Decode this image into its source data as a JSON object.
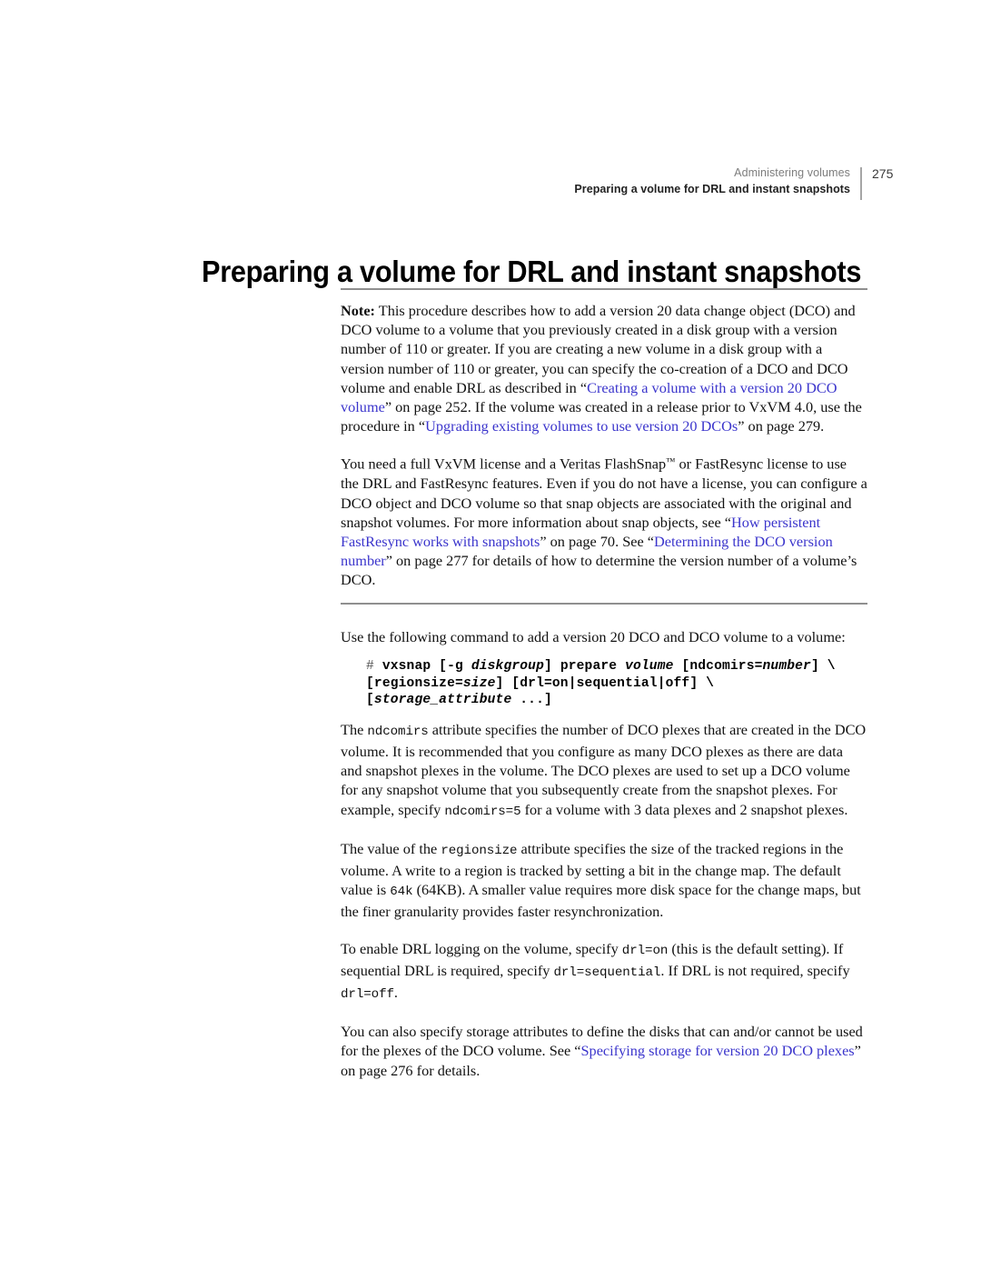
{
  "header": {
    "book_section": "Administering volumes",
    "topic": "Preparing a volume for DRL and instant snapshots",
    "page_number": "275"
  },
  "chapter_title": "Preparing a volume for DRL and instant snapshots",
  "note": {
    "label": "Note:",
    "text_1": " This procedure describes how to add a version 20 data change object (DCO) and DCO volume to a volume that you previously created in a disk group with a version number of 110 or greater. If you are creating a new volume in a disk group with a version number of 110 or greater, you can specify the co-creation of a DCO and DCO volume and enable DRL as described in “",
    "link_1": "Creating a volume with a version 20 DCO volume",
    "text_2": "” on page 252. If the volume was created in a release prior to VxVM 4.0, use the procedure in “",
    "link_2": "Upgrading existing volumes to use version 20 DCOs",
    "text_3": "” on page 279.",
    "para2_text_1": "You need a full VxVM license and a Veritas FlashSnap",
    "para2_tm": "™",
    "para2_text_2": " or FastResync license to use the DRL and FastResync features. Even if you do not have a license, you can configure a DCO object and DCO volume so that snap objects are associated with the original and snapshot volumes. For more information about snap objects, see “",
    "para2_link_1": "How persistent FastResync works with snapshots",
    "para2_text_3": "” on page 70. See “",
    "para2_link_2": "Determining the DCO version number",
    "para2_text_4": "” on page 277 for details of how to determine the version number of a volume’s DCO."
  },
  "body": {
    "intro": "Use the following command to add a version 20 DCO and DCO volume to a volume:",
    "command": {
      "prompt": "#",
      "line1_a": " vxsnap [-g ",
      "line1_var1": "diskgroup",
      "line1_b": "] prepare ",
      "line1_var2": "volume",
      "line1_c": " [ndcomirs=",
      "line1_var3": "number",
      "line1_d": "] \\",
      "line2_a": "[regionsize=",
      "line2_var1": "size",
      "line2_b": "] [drl=on|sequential|off] \\",
      "line3_a": "[",
      "line3_var1": "storage_attribute",
      "line3_b": " ...]"
    },
    "para_ndcomirs": {
      "t1": "The ",
      "c1": "ndcomirs",
      "t2": " attribute specifies the number of DCO plexes that are created in the DCO volume. It is recommended that you configure as many DCO plexes as there are data and snapshot plexes in the volume. The DCO plexes are used to set up a DCO volume for any snapshot volume that you subsequently create from the snapshot plexes. For example, specify ",
      "c2": "ndcomirs=5",
      "t3": " for a volume with 3 data plexes and 2 snapshot plexes."
    },
    "para_regionsize": {
      "t1": "The value of the ",
      "c1": "regionsize",
      "t2": " attribute specifies the size of the tracked regions in the volume. A write to a region is tracked by setting a bit in the change map. The default value is ",
      "c2": "64k",
      "t3": " (64KB). A smaller value requires more disk space for the change maps, but the finer granularity provides faster resynchronization."
    },
    "para_drl": {
      "t1": "To enable DRL logging on the volume, specify ",
      "c1": "drl=on",
      "t2": " (this is the default setting). If sequential DRL is required, specify ",
      "c2": "drl=sequential",
      "t3": ". If DRL is not required, specify ",
      "c3": "drl=off",
      "t4": "."
    },
    "para_storage": {
      "t1": "You can also specify storage attributes to define the disks that can and/or cannot be used for the plexes of the DCO volume. See “",
      "link1": "Specifying storage for version 20 DCO plexes",
      "t2": "” on page 276 for details."
    }
  },
  "colors": {
    "link": "#3b35cc",
    "rule": "#8f8f8f",
    "header_muted": "#7d7d7d",
    "text": "#111111"
  }
}
